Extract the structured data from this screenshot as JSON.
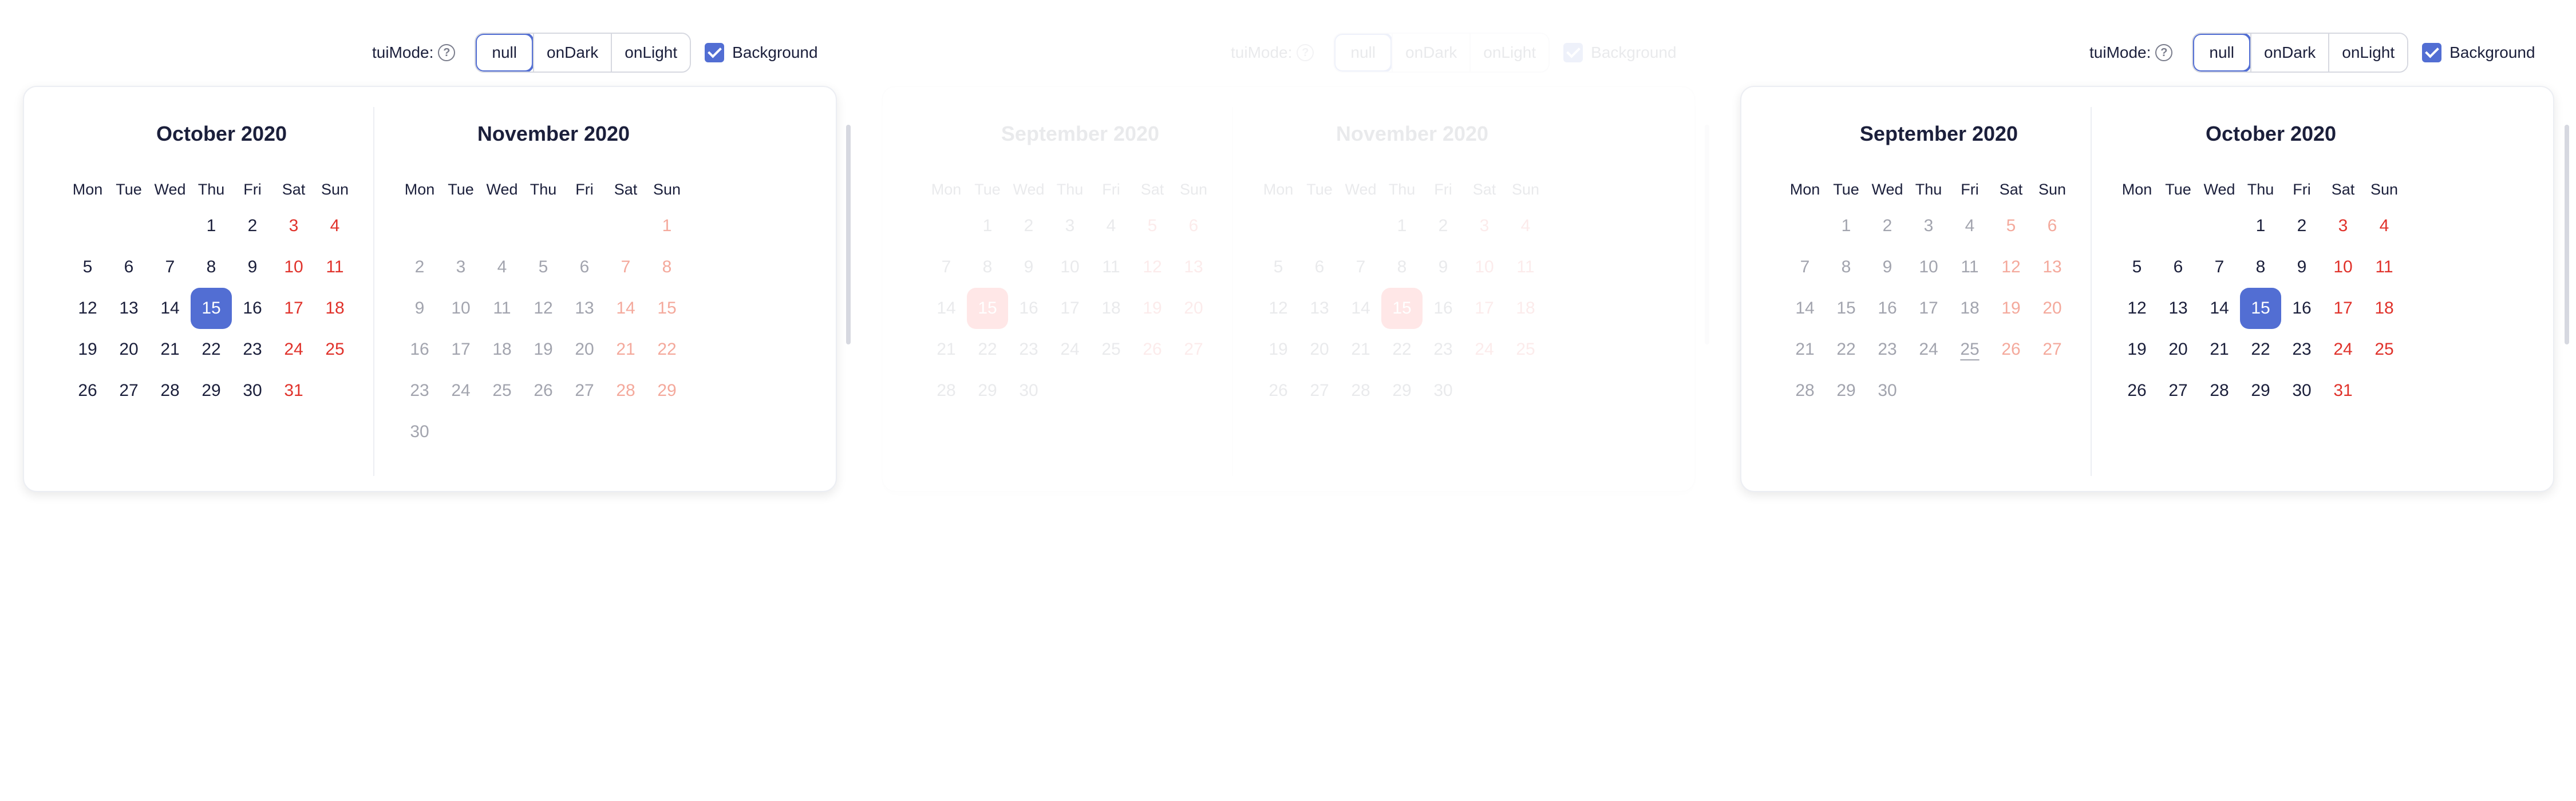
{
  "panels": [
    {
      "toolbar": {
        "mode_label": "tuiMode:",
        "modes": [
          "null",
          "onDark",
          "onLight"
        ],
        "background_label": "Background"
      },
      "calendar": {
        "weekdays": [
          "Mon",
          "Tue",
          "Wed",
          "Thu",
          "Fri",
          "Sat",
          "Sun"
        ],
        "months": [
          {
            "title": "October 2020",
            "offset": 3,
            "days": 31,
            "current": true,
            "selected": 15
          },
          {
            "title": "November 2020",
            "offset": 6,
            "days": 30,
            "current": false
          }
        ]
      }
    },
    {
      "toolbar": {
        "mode_label": "tuiMode:",
        "modes": [
          "null",
          "onDark",
          "onLight"
        ],
        "background_label": "Background"
      },
      "calendar": {
        "weekdays": [
          "Mon",
          "Tue",
          "Wed",
          "Thu",
          "Fri",
          "Sat",
          "Sun"
        ],
        "months": [
          {
            "title": "September 2020",
            "offset": 1,
            "days": 30,
            "current": true,
            "selected": 15
          },
          {
            "title": "November 2020",
            "offset": 3,
            "days": 30,
            "current": true,
            "selected": 15
          }
        ]
      }
    },
    {
      "toolbar": {
        "mode_label": "tuiMode:",
        "modes": [
          "null",
          "onDark",
          "onLight"
        ],
        "background_label": "Background"
      },
      "calendar": {
        "weekdays": [
          "Mon",
          "Tue",
          "Wed",
          "Thu",
          "Fri",
          "Sat",
          "Sun"
        ],
        "months": [
          {
            "title": "September 2020",
            "offset": 1,
            "days": 30,
            "current": false,
            "today": 25
          },
          {
            "title": "October 2020",
            "offset": 3,
            "days": 31,
            "current": true,
            "selected": 15
          }
        ]
      }
    }
  ],
  "colors": {
    "accent": "#526ed3",
    "weekend": "#e0322b",
    "weekend_muted": "#f4a99c",
    "text": "#1b1f3b",
    "muted": "#a2a4ae"
  }
}
